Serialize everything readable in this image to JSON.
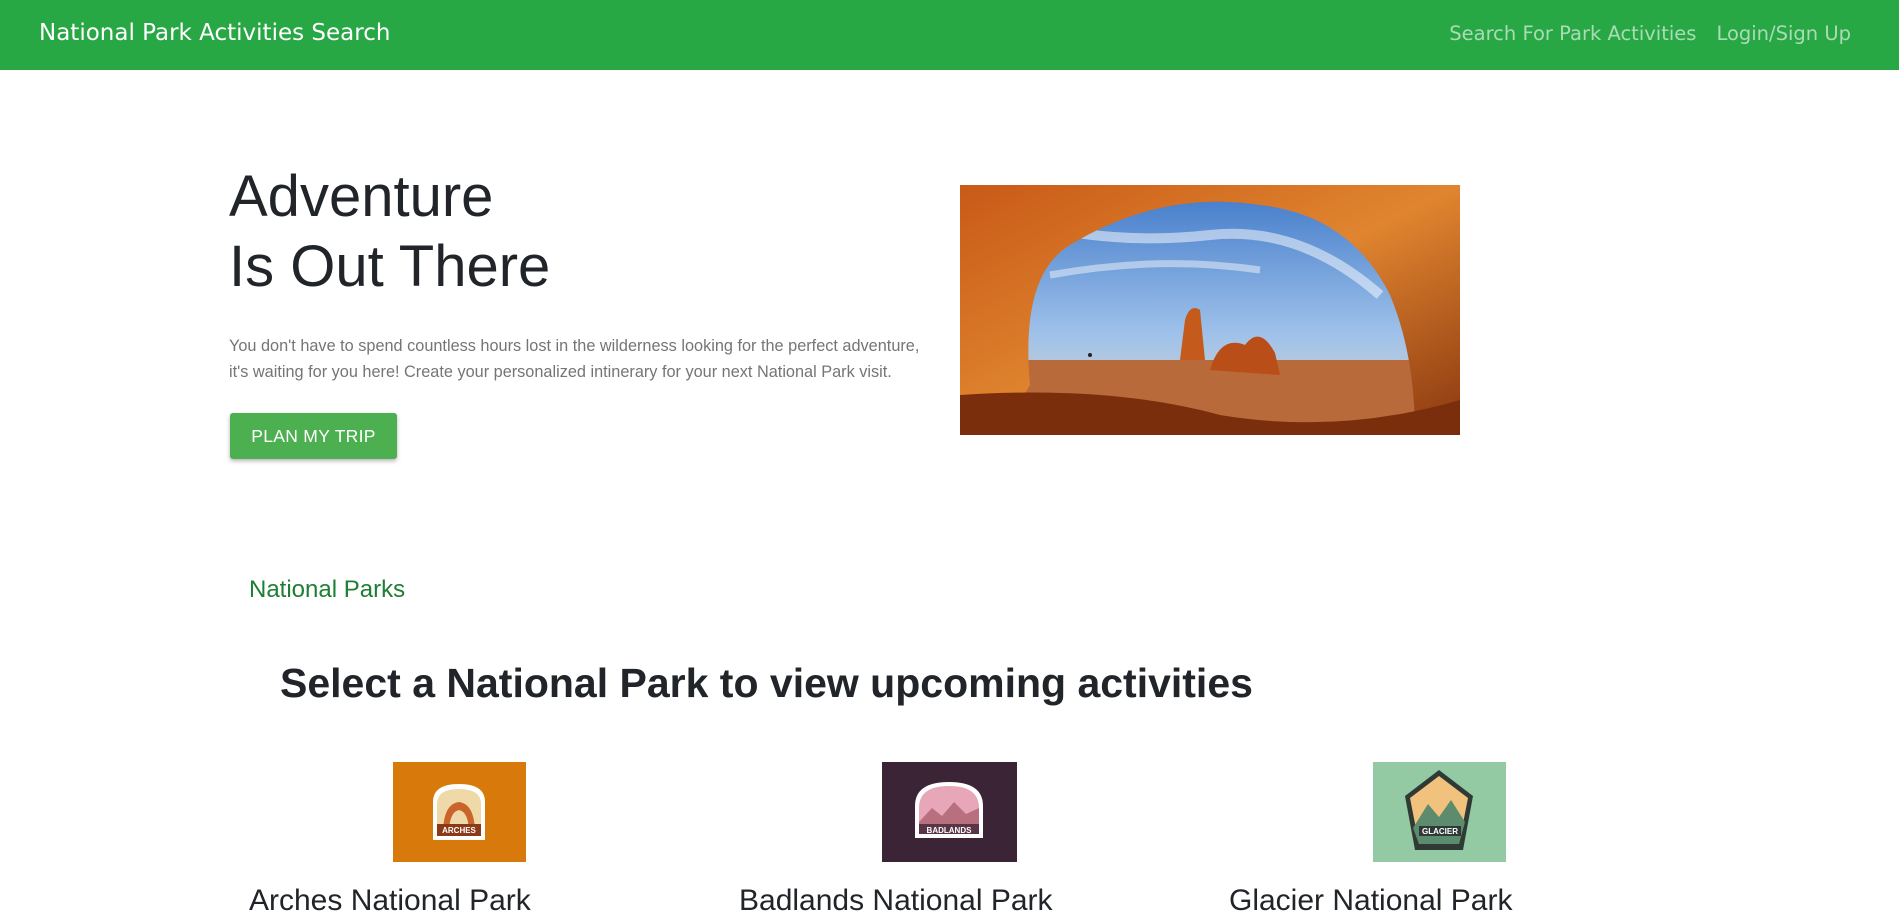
{
  "navbar": {
    "brand": "National Park Activities Search",
    "links": [
      "Search For Park Activities",
      "Login/Sign Up"
    ],
    "background": "#28a745"
  },
  "hero": {
    "title_line1": "Adventure",
    "title_line2": "Is Out There",
    "description_line1": "You don't have to spend countless hours lost in the wilderness looking for the perfect adventure,",
    "description_line2": "it's waiting for you here! Create your personalized intinerary for your next National Park visit.",
    "button_label": "PLAN MY TRIP",
    "button_color": "#4caf50"
  },
  "parks_section": {
    "link_label": "National Parks",
    "heading": "Select a National Park to view upcoming activities",
    "parks": [
      {
        "name": "Arches National Park",
        "badge": "ARCHES",
        "bg": "#d87a0b"
      },
      {
        "name": "Badlands National Park",
        "badge": "BADLANDS",
        "bg": "#3a2436"
      },
      {
        "name": "Glacier National Park",
        "badge": "GLACIER",
        "bg": "#93c9a3"
      }
    ]
  }
}
